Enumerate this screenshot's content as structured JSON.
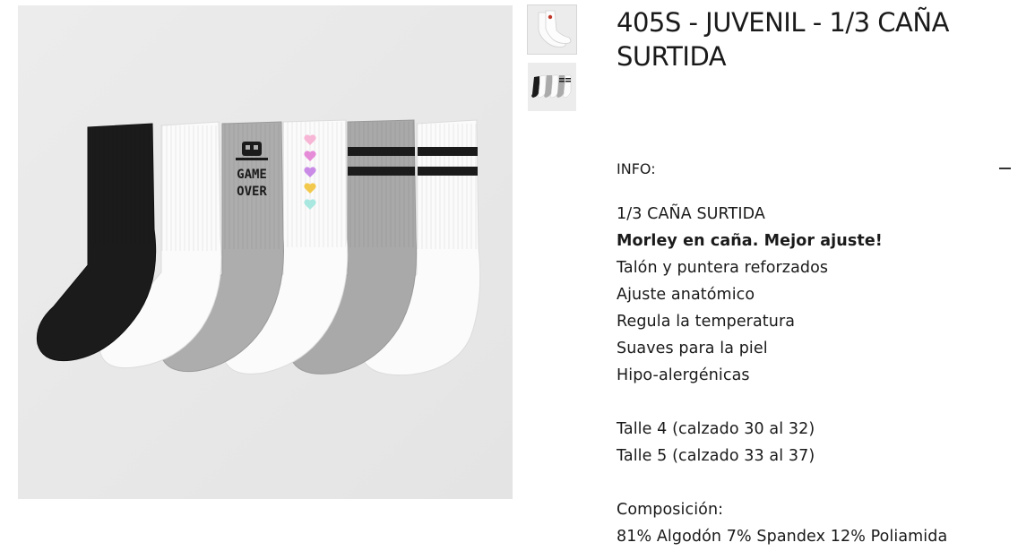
{
  "product": {
    "title": "405S - JUVENIL - 1/3 CAÑA SURTIDA",
    "main_image_alt": "Pack de 6 medias 1/3 caña surtidas",
    "sock_print_text": [
      "GAME",
      "OVER"
    ],
    "thumbnails": [
      {
        "alt": "Media blanca con detalle rojo",
        "active": true
      },
      {
        "alt": "Pack de medias surtidas",
        "active": false
      }
    ]
  },
  "info": {
    "label": "INFO:",
    "toggle_icon": "minus-icon",
    "expanded": true
  },
  "description": {
    "line1": "1/3 CAÑA SURTIDA",
    "line2": "Morley en caña. Mejor ajuste!",
    "line3": "Talón y puntera reforzados",
    "line4": "Ajuste anatómico",
    "line5": "Regula la temperatura",
    "line6": "Suaves para la piel",
    "line7": "Hipo-alergénicas",
    "size1": "Talle 4 (calzado 30 al 32)",
    "size2": "Talle 5 (calzado 33 al 37)",
    "composition_label": "Composición:",
    "composition_value": "81% Algodón 7% Spandex 12% Poliamida"
  },
  "colors": {
    "image_bg": "#e9e9e9",
    "sock_black": "#1b1b1b",
    "sock_white": "#fbfbfb",
    "sock_gray": "#a9a9a9",
    "hearts": [
      "#f7b6d6",
      "#e58bd8",
      "#c98be6",
      "#f2c94c",
      "#a9e8e0"
    ]
  }
}
